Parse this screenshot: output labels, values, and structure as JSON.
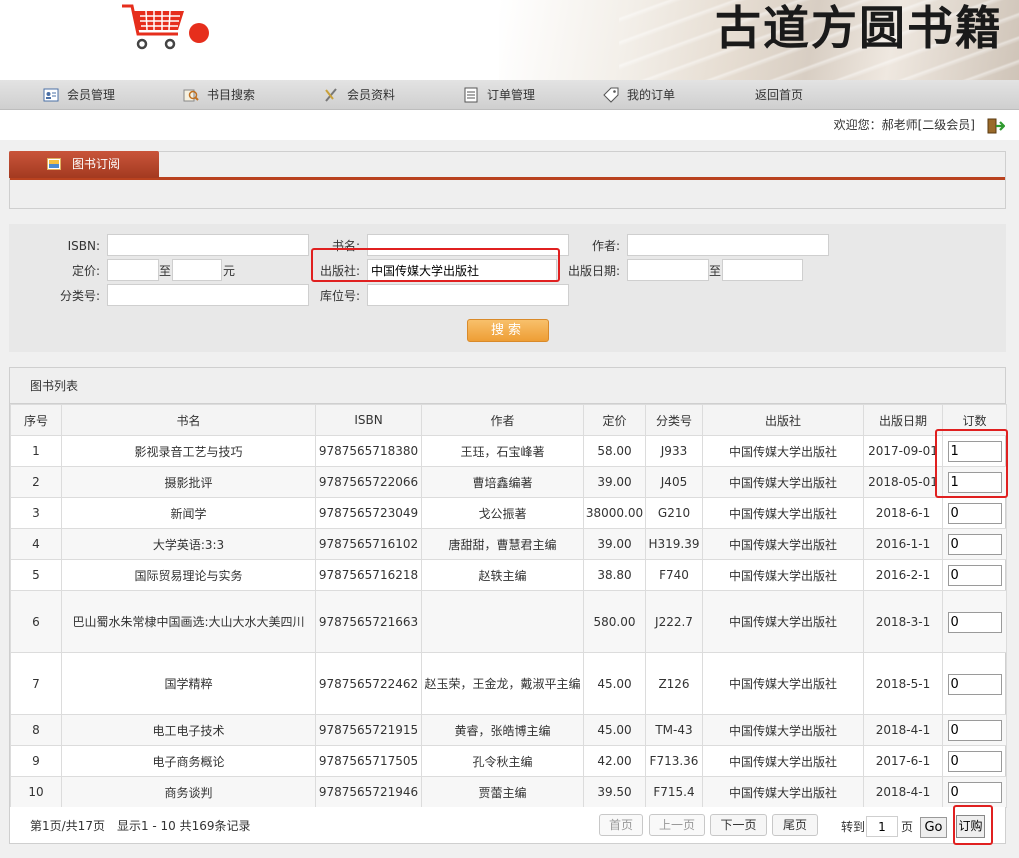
{
  "site": {
    "title": "古道方圆书籍"
  },
  "nav": [
    {
      "label": "会员管理",
      "icon": "member-icon"
    },
    {
      "label": "书目搜索",
      "icon": "search-icon"
    },
    {
      "label": "会员资料",
      "icon": "profile-edit-icon"
    },
    {
      "label": "订单管理",
      "icon": "order-doc-icon"
    },
    {
      "label": "我的订单",
      "icon": "tag-icon"
    },
    {
      "label": "返回首页",
      "icon": ""
    }
  ],
  "welcome": "欢迎您：郝老师[二级会员]",
  "panel_tab": "图书订阅",
  "search": {
    "isbn_label": "ISBN:",
    "isbn_value": "",
    "title_label": "书名:",
    "title_value": "",
    "author_label": "作者:",
    "author_value": "",
    "price_label": "定价:",
    "price_to": "至",
    "price_unit": "元",
    "publisher_label": "出版社:",
    "publisher_value": "中国传媒大学出版社",
    "date_label": "出版日期:",
    "date_to": "至",
    "class_label": "分类号:",
    "class_value": "",
    "location_label": "库位号:",
    "location_value": "",
    "button": "搜索"
  },
  "list": {
    "title": "图书列表",
    "headers": [
      "序号",
      "书名",
      "ISBN",
      "作者",
      "定价",
      "分类号",
      "出版社",
      "出版日期",
      "订数"
    ],
    "rows": [
      [
        "1",
        "影视录音工艺与技巧",
        "9787565718380",
        "王珏，石宝峰著",
        "58.00",
        "J933",
        "中国传媒大学出版社",
        "2017-09-01",
        "1"
      ],
      [
        "2",
        "摄影批评",
        "9787565722066",
        "曹培鑫编著",
        "39.00",
        "J405",
        "中国传媒大学出版社",
        "2018-05-01",
        "1"
      ],
      [
        "3",
        "新闻学",
        "9787565723049",
        "戈公振著",
        "38000.00",
        "G210",
        "中国传媒大学出版社",
        "2018-6-1",
        "0"
      ],
      [
        "4",
        "大学英语:3:3",
        "9787565716102",
        "唐甜甜，曹慧君主编",
        "39.00",
        "H319.39",
        "中国传媒大学出版社",
        "2016-1-1",
        "0"
      ],
      [
        "5",
        "国际贸易理论与实务",
        "9787565716218",
        "赵轶主编",
        "38.80",
        "F740",
        "中国传媒大学出版社",
        "2016-2-1",
        "0"
      ],
      [
        "6",
        "巴山蜀水朱常棣中国画选:大山大水大美四川",
        "9787565721663",
        "",
        "580.00",
        "J222.7",
        "中国传媒大学出版社",
        "2018-3-1",
        "0"
      ],
      [
        "7",
        "国学精粹",
        "9787565722462",
        "赵玉荣，王金龙，戴淑平主编",
        "45.00",
        "Z126",
        "中国传媒大学出版社",
        "2018-5-1",
        "0"
      ],
      [
        "8",
        "电工电子技术",
        "9787565721915",
        "黄睿，张皓博主编",
        "45.00",
        "TM-43",
        "中国传媒大学出版社",
        "2018-4-1",
        "0"
      ],
      [
        "9",
        "电子商务概论",
        "9787565717505",
        "孔令秋主编",
        "42.00",
        "F713.36",
        "中国传媒大学出版社",
        "2017-6-1",
        "0"
      ],
      [
        "10",
        "商务谈判",
        "9787565721946",
        "贾蕾主编",
        "39.50",
        "F715.4",
        "中国传媒大学出版社",
        "2018-4-1",
        "0"
      ]
    ]
  },
  "pager": {
    "info": "第1页/共17页　显示1 - 10 共169条记录",
    "first": "首页",
    "prev": "上一页",
    "next": "下一页",
    "last": "尾页",
    "goto": "转到",
    "page_value": "1",
    "page_unit": "页",
    "go": "Go",
    "order": "订购"
  },
  "colors": {
    "accent": "#b9421f",
    "button": "#ee9e35",
    "annotation": "#e02020"
  }
}
